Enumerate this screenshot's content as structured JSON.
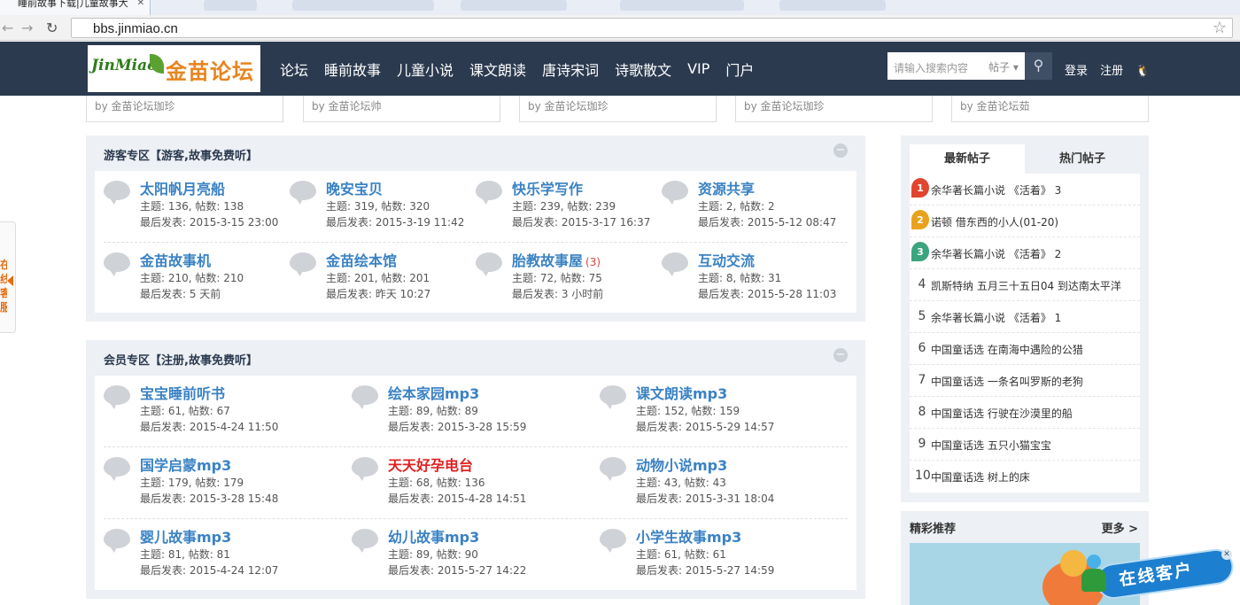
{
  "browser": {
    "tab_title": "睡前故事下载|儿童故事大",
    "url": "bbs.jinmiao.cn"
  },
  "header": {
    "logo_latin": "JinMiao",
    "logo_cn": "金苗论坛",
    "nav": [
      "论坛",
      "睡前故事",
      "儿童小说",
      "课文朗读",
      "唐诗宋词",
      "诗歌散文",
      "VIP",
      "门户"
    ],
    "search_placeholder": "请输入搜索内容",
    "search_type": "帖子",
    "login": "登录",
    "register": "注册"
  },
  "top_cards": [
    "by 金苗论坛珈珍",
    "by 金苗论坛帅",
    "by 金苗论坛珈珍",
    "by 金苗论坛珈珍",
    "by 金苗论坛茹"
  ],
  "guest_zone": {
    "title": "游客专区【游客,故事免费听】",
    "forums": [
      {
        "name": "太阳帆月亮船",
        "stats": "主题: 136, 帖数: 138",
        "last": "最后发表: 2015-3-15 23:00"
      },
      {
        "name": "晚安宝贝",
        "stats": "主题: 319, 帖数: 320",
        "last": "最后发表: 2015-3-19 11:42"
      },
      {
        "name": "快乐学写作",
        "stats": "主题: 239, 帖数: 239",
        "last": "最后发表: 2015-3-17 16:37"
      },
      {
        "name": "资源共享",
        "stats": "主题: 2, 帖数: 2",
        "last": "最后发表: 2015-5-12 08:47"
      },
      {
        "name": "金苗故事机",
        "stats": "主题: 210, 帖数: 210",
        "last": "最后发表: 5 天前"
      },
      {
        "name": "金苗绘本馆",
        "stats": "主题: 201, 帖数: 201",
        "last": "最后发表: 昨天 10:27"
      },
      {
        "name": "胎教故事屋",
        "count": "(3)",
        "stats": "主题: 72, 帖数: 75",
        "last": "最后发表: 3 小时前"
      },
      {
        "name": "互动交流",
        "stats": "主题: 8, 帖数: 31",
        "last": "最后发表: 2015-5-28 11:03"
      }
    ]
  },
  "member_zone": {
    "title": "会员专区【注册,故事免费听】",
    "forums": [
      {
        "name": "宝宝睡前听书",
        "stats": "主题: 61, 帖数: 67",
        "last": "最后发表: 2015-4-24 11:50"
      },
      {
        "name": "绘本家园mp3",
        "stats": "主题: 89, 帖数: 89",
        "last": "最后发表: 2015-3-28 15:59"
      },
      {
        "name": "课文朗读mp3",
        "stats": "主题: 152, 帖数: 159",
        "last": "最后发表: 2015-5-29 14:57"
      },
      {
        "name": "国学启蒙mp3",
        "stats": "主题: 179, 帖数: 179",
        "last": "最后发表: 2015-3-28 15:48"
      },
      {
        "name": "天天好孕电台",
        "stats": "主题: 68, 帖数: 136",
        "last": "最后发表: 2015-4-28 14:51"
      },
      {
        "name": "动物小说mp3",
        "stats": "主题: 43, 帖数: 43",
        "last": "最后发表: 2015-3-31 18:04"
      },
      {
        "name": "婴儿故事mp3",
        "stats": "主题: 81, 帖数: 81",
        "last": "最后发表: 2015-4-24 12:07"
      },
      {
        "name": "幼儿故事mp3",
        "stats": "主题: 89, 帖数: 90",
        "last": "最后发表: 2015-5-27 14:22"
      },
      {
        "name": "小学生故事mp3",
        "stats": "主题: 61, 帖数: 61",
        "last": "最后发表: 2015-5-27 14:59"
      }
    ]
  },
  "sidebar": {
    "tab_latest": "最新帖子",
    "tab_hot": "热门帖子",
    "posts": [
      {
        "rank": "1",
        "title": "余华著长篇小说 《活着》 3"
      },
      {
        "rank": "2",
        "title": "诺顿 借东西的小人(01-20)"
      },
      {
        "rank": "3",
        "title": "余华著长篇小说 《活着》 2"
      },
      {
        "rank": "4",
        "title": "凯斯特纳 五月三十五日04 到达南太平洋"
      },
      {
        "rank": "5",
        "title": "余华著长篇小说 《活着》 1"
      },
      {
        "rank": "6",
        "title": "中国童话选 在南海中遇险的公猎"
      },
      {
        "rank": "7",
        "title": "中国童话选 一条名叫罗斯的老狗"
      },
      {
        "rank": "8",
        "title": "中国童话选 行驶在沙漠里的船"
      },
      {
        "rank": "9",
        "title": "中国童话选 五只小猫宝宝"
      },
      {
        "rank": "10",
        "title": "中国童话选 树上的床"
      }
    ],
    "featured_title": "精彩推荐",
    "featured_more": "更多 >"
  },
  "float_left_label": "在线客服",
  "float_service_label": "在线客户",
  "colors": {
    "header_bg": "#2b3a4f",
    "link_blue": "#3a82c4",
    "highlight_red": "#e02020",
    "flame_colors": [
      "#e2452f",
      "#e9a21d",
      "#3aa57f"
    ]
  }
}
